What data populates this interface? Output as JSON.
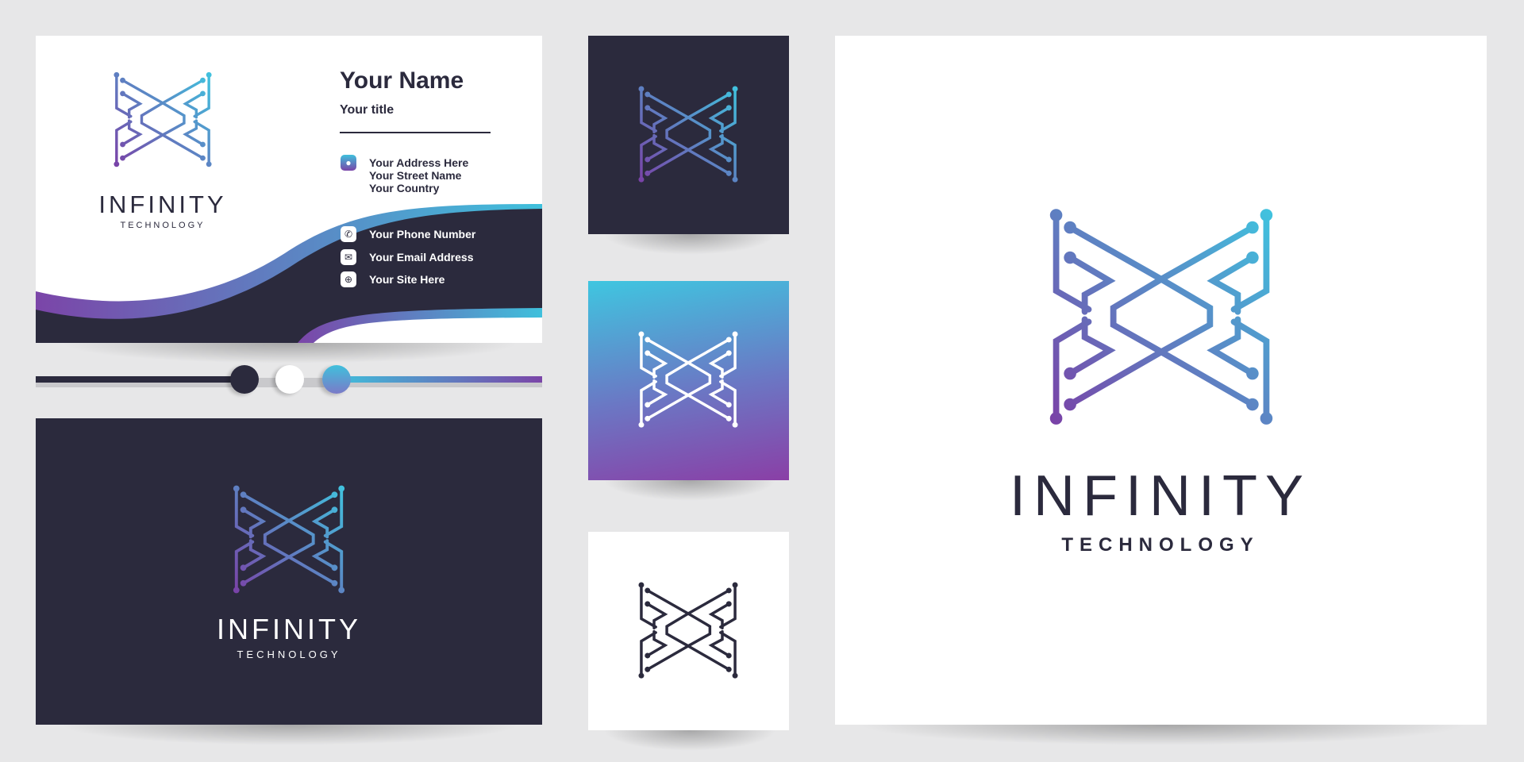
{
  "brand": {
    "name": "INFINITY",
    "tagline": "TECHNOLOGY"
  },
  "card": {
    "name": "Your Name",
    "title": "Your title",
    "address": [
      "Your Address Here",
      "Your Street Name",
      "Your Country"
    ],
    "phone": "Your Phone Number",
    "email": "Your Email Address",
    "site": "Your Site Here"
  },
  "icons": {
    "address": "location-pin-icon",
    "phone": "phone-icon",
    "email": "envelope-icon",
    "site": "globe-icon"
  },
  "colors": {
    "background": "#e7e7e8",
    "dark": "#2b2a3d",
    "purple": "#7b45a8",
    "cyan": "#3fc0dc",
    "white": "#ffffff"
  }
}
